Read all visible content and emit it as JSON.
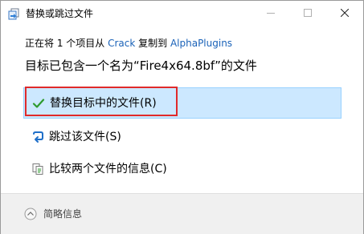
{
  "window": {
    "title": "替换或跳过文件"
  },
  "copy_info": {
    "prefix": "正在将 1 个项目从 ",
    "source": "Crack",
    "middle": " 复制到 ",
    "destination": "AlphaPlugins"
  },
  "heading": "目标已包含一个名为“Fire4x64.8bf”的文件",
  "options": {
    "replace": "替换目标中的文件(R)",
    "skip": "跳过该文件(S)",
    "compare": "比较两个文件的信息(C)"
  },
  "footer": {
    "details_label": "简略信息"
  },
  "colors": {
    "selected_bg": "#cce8ff",
    "selected_border": "#99d1ff",
    "highlight": "#e02a2a",
    "link": "#1a62b8",
    "check": "#2e9b2e"
  }
}
